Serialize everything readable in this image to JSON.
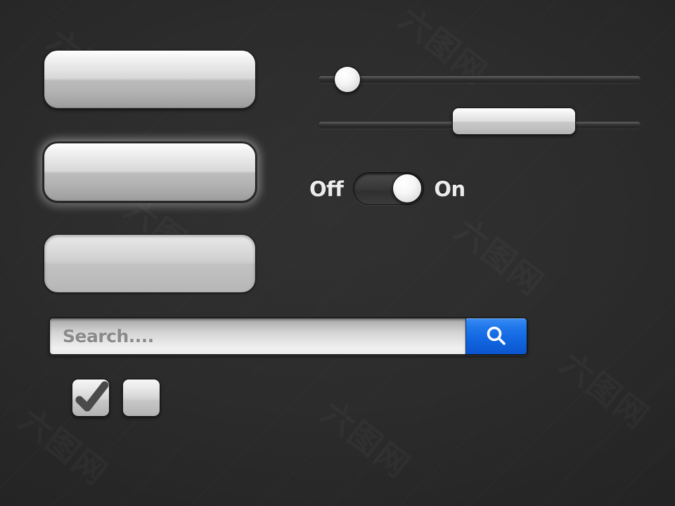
{
  "theme": {
    "background_color": "#2b2b2b",
    "accent_color": "#1368e2",
    "button_light": "#ffffff",
    "button_dark": "#9c9c9c",
    "label_color": "#ececed",
    "placeholder_color": "#8a8a8a"
  },
  "buttons": [
    {
      "name": "button-normal",
      "state": "normal",
      "label": ""
    },
    {
      "name": "button-focus",
      "state": "focus",
      "label": ""
    },
    {
      "name": "button-pressed",
      "state": "pressed",
      "label": ""
    }
  ],
  "sliders": [
    {
      "name": "slider-round-knob",
      "knob_shape": "circle",
      "value_percent": 12
    },
    {
      "name": "slider-rect-knob",
      "knob_shape": "rounded-rect",
      "value_percent": 62
    }
  ],
  "toggle": {
    "off_label": "Off",
    "on_label": "On",
    "state": "on"
  },
  "search": {
    "placeholder": "Search....",
    "value": "",
    "button_icon": "search-icon"
  },
  "checkboxes": [
    {
      "name": "checkbox-checked",
      "checked": true,
      "icon": "check-icon"
    },
    {
      "name": "checkbox-unchecked",
      "checked": false,
      "icon": ""
    }
  ],
  "watermarks": [
    "6",
    "六",
    "图",
    "网"
  ]
}
